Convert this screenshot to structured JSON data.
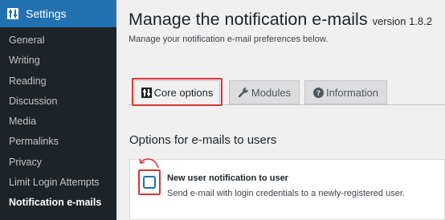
{
  "sidebar": {
    "header": {
      "title": "Settings",
      "icon": "settings-sliders-icon"
    },
    "items": [
      {
        "label": "General"
      },
      {
        "label": "Writing"
      },
      {
        "label": "Reading"
      },
      {
        "label": "Discussion"
      },
      {
        "label": "Media"
      },
      {
        "label": "Permalinks"
      },
      {
        "label": "Privacy"
      },
      {
        "label": "Limit Login Attempts"
      },
      {
        "label": "Notification e-mails",
        "current": true
      }
    ]
  },
  "page": {
    "title": "Manage the notification e-mails",
    "version": "version 1.8.2",
    "subtitle": "Manage your notification e-mail preferences below."
  },
  "tabs": [
    {
      "label": "Core options",
      "icon": "core-options-icon",
      "active": true
    },
    {
      "label": "Modules",
      "icon": "wrench-icon"
    },
    {
      "label": "Information",
      "icon": "question-circle-icon"
    }
  ],
  "section": {
    "title": "Options for e-mails to users"
  },
  "option": {
    "label": "New user notification to user",
    "description": "Send e-mail with login credentials to a newly-registered user.",
    "checked": false
  },
  "colors": {
    "sidebar_bg": "#1d2327",
    "accent": "#2271b1",
    "highlight": "#d63638",
    "page_bg": "#f0f0f1"
  }
}
